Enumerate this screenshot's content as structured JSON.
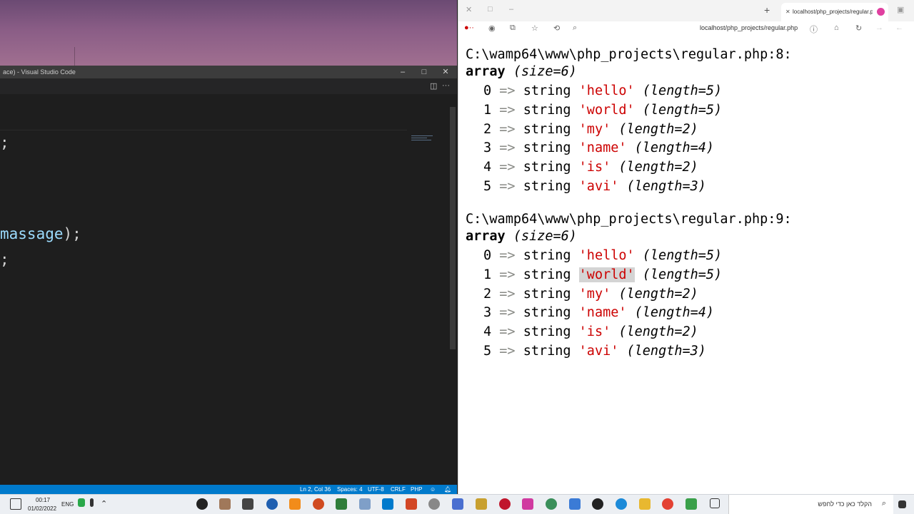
{
  "vscode": {
    "title": "ace) - Visual Studio Code",
    "code_lines": [
      ";",
      "massage);",
      ";"
    ],
    "code_identifier": "massage",
    "code_suffix": ");",
    "status": {
      "position": "Ln 2, Col 36",
      "spaces": "Spaces: 4",
      "encoding": "UTF-8",
      "eol": "CRLF",
      "language": "PHP"
    }
  },
  "browser": {
    "tab_title": "localhost/php_projects/regular.p",
    "url": "localhost/php_projects/regular.php",
    "dumps": [
      {
        "path": "C:\\wamp64\\www\\php_projects\\regular.php:8:",
        "array_word": "array",
        "size": "(size=6)",
        "rows": [
          {
            "index": "0",
            "arrow": "=>",
            "type": "string",
            "value": "'hello'",
            "length": "(length=5)"
          },
          {
            "index": "1",
            "arrow": "=>",
            "type": "string",
            "value": "'world'",
            "length": "(length=5)"
          },
          {
            "index": "2",
            "arrow": "=>",
            "type": "string",
            "value": "'my'",
            "length": "(length=2)"
          },
          {
            "index": "3",
            "arrow": "=>",
            "type": "string",
            "value": "'name'",
            "length": "(length=4)"
          },
          {
            "index": "4",
            "arrow": "=>",
            "type": "string",
            "value": "'is'",
            "length": "(length=2)"
          },
          {
            "index": "5",
            "arrow": "=>",
            "type": "string",
            "value": "'avi'",
            "length": "(length=3)"
          }
        ]
      },
      {
        "path": "C:\\wamp64\\www\\php_projects\\regular.php:9:",
        "array_word": "array",
        "size": "(size=6)",
        "rows": [
          {
            "index": "0",
            "arrow": "=>",
            "type": "string",
            "value": "'hello'",
            "length": "(length=5)"
          },
          {
            "index": "1",
            "arrow": "=>",
            "type": "string",
            "value": "'world'",
            "length": "(length=5)"
          },
          {
            "index": "2",
            "arrow": "=>",
            "type": "string",
            "value": "'my'",
            "length": "(length=2)"
          },
          {
            "index": "3",
            "arrow": "=>",
            "type": "string",
            "value": "'name'",
            "length": "(length=4)"
          },
          {
            "index": "4",
            "arrow": "=>",
            "type": "string",
            "value": "'is'",
            "length": "(length=2)"
          },
          {
            "index": "5",
            "arrow": "=>",
            "type": "string",
            "value": "'avi'",
            "length": "(length=3)"
          }
        ]
      }
    ]
  },
  "taskbar": {
    "time": "00:17",
    "date": "01/02/2022",
    "language": "ENG",
    "search_placeholder": "הקלד כאן כדי לחפש"
  }
}
